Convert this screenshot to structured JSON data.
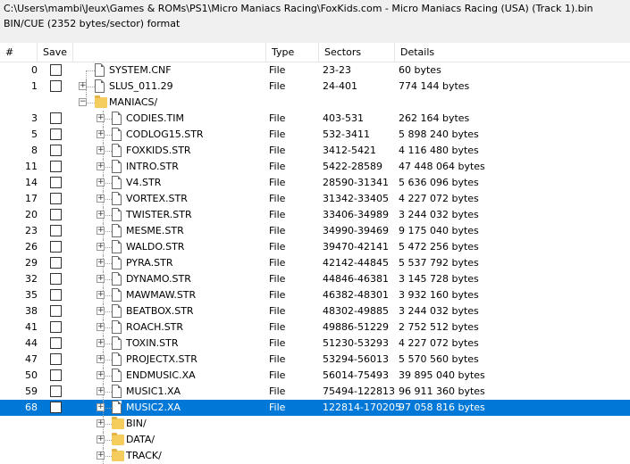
{
  "header": {
    "path": "C:\\Users\\mambi\\Jeux\\Games & ROMs\\PS1\\Micro Maniacs Racing\\FoxKids.com - Micro Maniacs Racing (USA) (Track 1).bin",
    "format": "BIN/CUE (2352 bytes/sector) format"
  },
  "columns": {
    "num": "#",
    "save": "Save",
    "type": "Type",
    "sectors": "Sectors",
    "details": "Details"
  },
  "rows": [
    {
      "num": "0",
      "name": "SYSTEM.CNF",
      "type": "File",
      "sectors": "23-23",
      "details": "60 bytes",
      "level": 0,
      "expander": false,
      "icon": "file-icon",
      "selected": false
    },
    {
      "num": "1",
      "name": "SLUS_011.29",
      "type": "File",
      "sectors": "24-401",
      "details": "774 144 bytes",
      "level": 0,
      "expander": true,
      "icon": "file-icon",
      "selected": false
    },
    {
      "num": "",
      "name": "MANIACS/",
      "type": "",
      "sectors": "",
      "details": "",
      "level": 0,
      "expander": false,
      "icon": "folder-icon",
      "selected": false
    },
    {
      "num": "3",
      "name": "CODIES.TIM",
      "type": "File",
      "sectors": "403-531",
      "details": "262 164 bytes",
      "level": 1,
      "expander": true,
      "icon": "file-icon",
      "selected": false
    },
    {
      "num": "5",
      "name": "CODLOG15.STR",
      "type": "File",
      "sectors": "532-3411",
      "details": "5 898 240 bytes",
      "level": 1,
      "expander": true,
      "icon": "file-icon",
      "selected": false
    },
    {
      "num": "8",
      "name": "FOXKIDS.STR",
      "type": "File",
      "sectors": "3412-5421",
      "details": "4 116 480 bytes",
      "level": 1,
      "expander": true,
      "icon": "file-icon",
      "selected": false
    },
    {
      "num": "11",
      "name": "INTRO.STR",
      "type": "File",
      "sectors": "5422-28589",
      "details": "47 448 064 bytes",
      "level": 1,
      "expander": true,
      "icon": "file-icon",
      "selected": false
    },
    {
      "num": "14",
      "name": "V4.STR",
      "type": "File",
      "sectors": "28590-31341",
      "details": "5 636 096 bytes",
      "level": 1,
      "expander": true,
      "icon": "file-icon",
      "selected": false
    },
    {
      "num": "17",
      "name": "VORTEX.STR",
      "type": "File",
      "sectors": "31342-33405",
      "details": "4 227 072 bytes",
      "level": 1,
      "expander": true,
      "icon": "file-icon",
      "selected": false
    },
    {
      "num": "20",
      "name": "TWISTER.STR",
      "type": "File",
      "sectors": "33406-34989",
      "details": "3 244 032 bytes",
      "level": 1,
      "expander": true,
      "icon": "file-icon",
      "selected": false
    },
    {
      "num": "23",
      "name": "MESME.STR",
      "type": "File",
      "sectors": "34990-39469",
      "details": "9 175 040 bytes",
      "level": 1,
      "expander": true,
      "icon": "file-icon",
      "selected": false
    },
    {
      "num": "26",
      "name": "WALDO.STR",
      "type": "File",
      "sectors": "39470-42141",
      "details": "5 472 256 bytes",
      "level": 1,
      "expander": true,
      "icon": "file-icon",
      "selected": false
    },
    {
      "num": "29",
      "name": "PYRA.STR",
      "type": "File",
      "sectors": "42142-44845",
      "details": "5 537 792 bytes",
      "level": 1,
      "expander": true,
      "icon": "file-icon",
      "selected": false
    },
    {
      "num": "32",
      "name": "DYNAMO.STR",
      "type": "File",
      "sectors": "44846-46381",
      "details": "3 145 728 bytes",
      "level": 1,
      "expander": true,
      "icon": "file-icon",
      "selected": false
    },
    {
      "num": "35",
      "name": "MAWMAW.STR",
      "type": "File",
      "sectors": "46382-48301",
      "details": "3 932 160 bytes",
      "level": 1,
      "expander": true,
      "icon": "file-icon",
      "selected": false
    },
    {
      "num": "38",
      "name": "BEATBOX.STR",
      "type": "File",
      "sectors": "48302-49885",
      "details": "3 244 032 bytes",
      "level": 1,
      "expander": true,
      "icon": "file-icon",
      "selected": false
    },
    {
      "num": "41",
      "name": "ROACH.STR",
      "type": "File",
      "sectors": "49886-51229",
      "details": "2 752 512 bytes",
      "level": 1,
      "expander": true,
      "icon": "file-icon",
      "selected": false
    },
    {
      "num": "44",
      "name": "TOXIN.STR",
      "type": "File",
      "sectors": "51230-53293",
      "details": "4 227 072 bytes",
      "level": 1,
      "expander": true,
      "icon": "file-icon",
      "selected": false
    },
    {
      "num": "47",
      "name": "PROJECTX.STR",
      "type": "File",
      "sectors": "53294-56013",
      "details": "5 570 560 bytes",
      "level": 1,
      "expander": true,
      "icon": "file-icon",
      "selected": false
    },
    {
      "num": "50",
      "name": "ENDMUSIC.XA",
      "type": "File",
      "sectors": "56014-75493",
      "details": "39 895 040 bytes",
      "level": 1,
      "expander": true,
      "icon": "file-icon",
      "selected": false
    },
    {
      "num": "59",
      "name": "MUSIC1.XA",
      "type": "File",
      "sectors": "75494-122813",
      "details": "96 911 360 bytes",
      "level": 1,
      "expander": true,
      "icon": "file-icon",
      "selected": false
    },
    {
      "num": "68",
      "name": "MUSIC2.XA",
      "type": "File",
      "sectors": "122814-170205",
      "details": "97 058 816 bytes",
      "level": 1,
      "expander": true,
      "icon": "file-icon",
      "selected": true
    },
    {
      "num": "",
      "name": "BIN/",
      "type": "",
      "sectors": "",
      "details": "",
      "level": 1,
      "expander": true,
      "icon": "folder-icon",
      "selected": false
    },
    {
      "num": "",
      "name": "DATA/",
      "type": "",
      "sectors": "",
      "details": "",
      "level": 1,
      "expander": true,
      "icon": "folder-icon",
      "selected": false
    },
    {
      "num": "",
      "name": "TRACK/",
      "type": "",
      "sectors": "",
      "details": "",
      "level": 1,
      "expander": true,
      "icon": "folder-icon",
      "selected": false
    }
  ],
  "colors": {
    "selection": "#0078d7",
    "header_bg": "#f0f0f0",
    "folder": "#f5cc5e"
  }
}
